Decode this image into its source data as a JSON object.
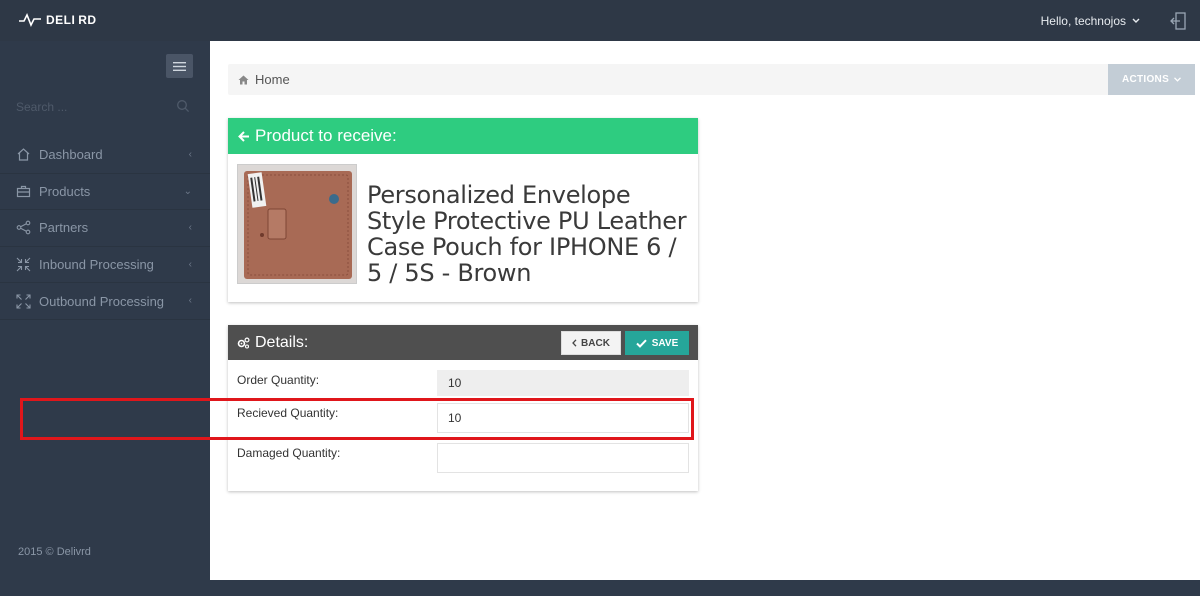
{
  "app": {
    "logo_text": "DELI RD",
    "user_greeting": "Hello, technojos",
    "footer": "2015 © Delivrd"
  },
  "sidebar": {
    "search_placeholder": "Search ...",
    "items": [
      {
        "label": "Dashboard",
        "icon": "home-icon"
      },
      {
        "label": "Products",
        "icon": "briefcase-icon"
      },
      {
        "label": "Partners",
        "icon": "share-icon"
      },
      {
        "label": "Inbound Processing",
        "icon": "shrink-icon"
      },
      {
        "label": "Outbound Processing",
        "icon": "expand-icon"
      }
    ]
  },
  "breadcrumb": {
    "home": "Home",
    "actions_label": "ACTIONS"
  },
  "product": {
    "header": "Product to receive:",
    "title": "Personalized Envelope Style Protective PU Leather Case Pouch for IPHONE 6 / 5 / 5S - Brown"
  },
  "details": {
    "header": "Details:",
    "back_label": "BACK",
    "save_label": "SAVE",
    "order_quantity_label": "Order Quantity:",
    "order_quantity_value": "10",
    "received_quantity_label": "Recieved Quantity:",
    "received_quantity_value": "10",
    "damaged_quantity_label": "Damaged Quantity:",
    "damaged_quantity_value": ""
  },
  "colors": {
    "topbar": "#2e3846",
    "sidebar": "#2f3a4a",
    "product_header": "#2ecc80",
    "details_header": "#4f4f4f",
    "save_button": "#26a69a",
    "actions_button": "#c3cdd6",
    "highlight": "#e0161b"
  }
}
